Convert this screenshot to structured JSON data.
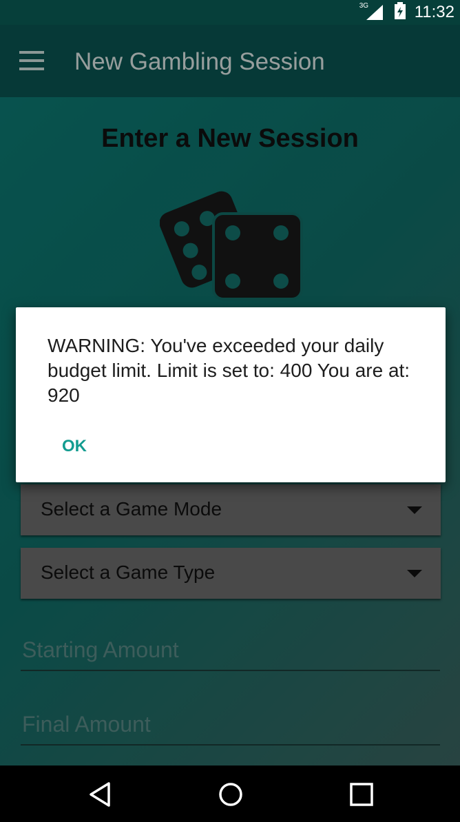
{
  "status_bar": {
    "network": "3G",
    "time": "11:32"
  },
  "app_bar": {
    "title": "New Gambling Session",
    "menu_icon": "hamburger-menu-icon"
  },
  "page": {
    "heading": "Enter a New Session",
    "illustration_icon": "dice-icon"
  },
  "form": {
    "game_mode": {
      "selected": "Select a Game Mode"
    },
    "game_type": {
      "selected": "Select a Game Type"
    },
    "starting_amount": {
      "placeholder": "Starting Amount",
      "value": ""
    },
    "final_amount": {
      "placeholder": "Final Amount",
      "value": ""
    }
  },
  "dialog": {
    "message": "WARNING: You've exceeded your daily budget limit. Limit is set to: 400 You are at: 920",
    "ok_label": "OK"
  },
  "nav_bar": {
    "buttons": [
      "back-icon",
      "home-icon",
      "recents-icon"
    ]
  },
  "colors": {
    "primary_dark": "#063f3a",
    "primary": "#0a5551",
    "accent": "#139c90"
  }
}
